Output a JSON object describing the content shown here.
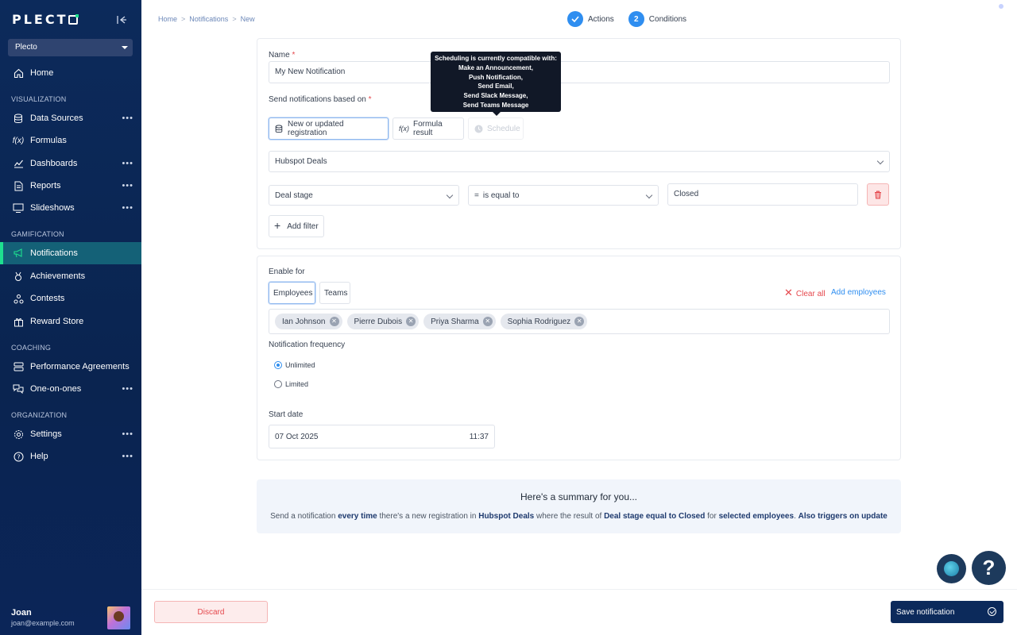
{
  "app": {
    "logo": "PLECTO",
    "workspace": "Plecto"
  },
  "nav": {
    "home": "Home",
    "sections": {
      "visualization": "VISUALIZATION",
      "gamification": "GAMIFICATION",
      "coaching": "COACHING",
      "organization": "ORGANIZATION"
    },
    "items": {
      "data_sources": "Data Sources",
      "formulas": "Formulas",
      "dashboards": "Dashboards",
      "reports": "Reports",
      "slideshows": "Slideshows",
      "notifications": "Notifications",
      "achievements": "Achievements",
      "contests": "Contests",
      "reward_store": "Reward Store",
      "performance_agreements": "Performance Agreements",
      "one_on_ones": "One-on-ones",
      "settings": "Settings",
      "help": "Help"
    },
    "more": "•••"
  },
  "user": {
    "name": "Joan",
    "email": "joan@example.com"
  },
  "breadcrumb": {
    "home": "Home",
    "notifications": "Notifications",
    "current": "New",
    "sep": ">"
  },
  "steps": [
    {
      "label": "Actions",
      "state": "done"
    },
    {
      "number": "2",
      "label": "Conditions"
    }
  ],
  "form": {
    "name_label": "Name",
    "required_mark": "*",
    "name_value": "My New Notification",
    "send_based_label": "Send notifications based on",
    "options": {
      "registration": "New or updated registration",
      "formula": "Formula result",
      "schedule": "Schedule"
    },
    "tooltip": [
      "Scheduling is currently compatible with:",
      "Make an Announcement,",
      "Push Notification,",
      "Send Email,",
      "Send Slack Message,",
      "Send Teams Message"
    ],
    "data_source": "Hubspot Deals",
    "filter": {
      "field": "Deal stage",
      "operator": "is equal to",
      "value": "Closed"
    },
    "add_filter": "Add filter"
  },
  "enable": {
    "label": "Enable for",
    "tabs": {
      "employees": "Employees",
      "teams": "Teams"
    },
    "clear_all": "Clear all",
    "add_employees": "Add employees",
    "employees": [
      "Ian Johnson",
      "Pierre Dubois",
      "Priya Sharma",
      "Sophia Rodriguez"
    ],
    "frequency_label": "Notification frequency",
    "frequency": {
      "unlimited": "Unlimited",
      "limited": "Limited",
      "selected": "Unlimited"
    },
    "start_label": "Start date",
    "start_date": "07 Oct 2025",
    "start_time": "11:37"
  },
  "summary": {
    "title": "Here's a summary for you...",
    "p1": "Send a notification ",
    "b1": "every time",
    "p2": " there's a new registration in ",
    "b2": "Hubspot Deals",
    "p3": " where the result of ",
    "b3": "Deal stage equal to Closed",
    "p4": " for ",
    "b4": "selected employees",
    "p5": ". ",
    "b5": "Also triggers on update"
  },
  "footer": {
    "discard": "Discard",
    "save": "Save notification"
  },
  "help": {
    "label": "?"
  },
  "colors": {
    "sidebar": "#0c2a5b",
    "accent": "#2f8ef0",
    "active_nav": "#146177",
    "danger": "#e5484d",
    "brand_green": "#1ee08f"
  }
}
